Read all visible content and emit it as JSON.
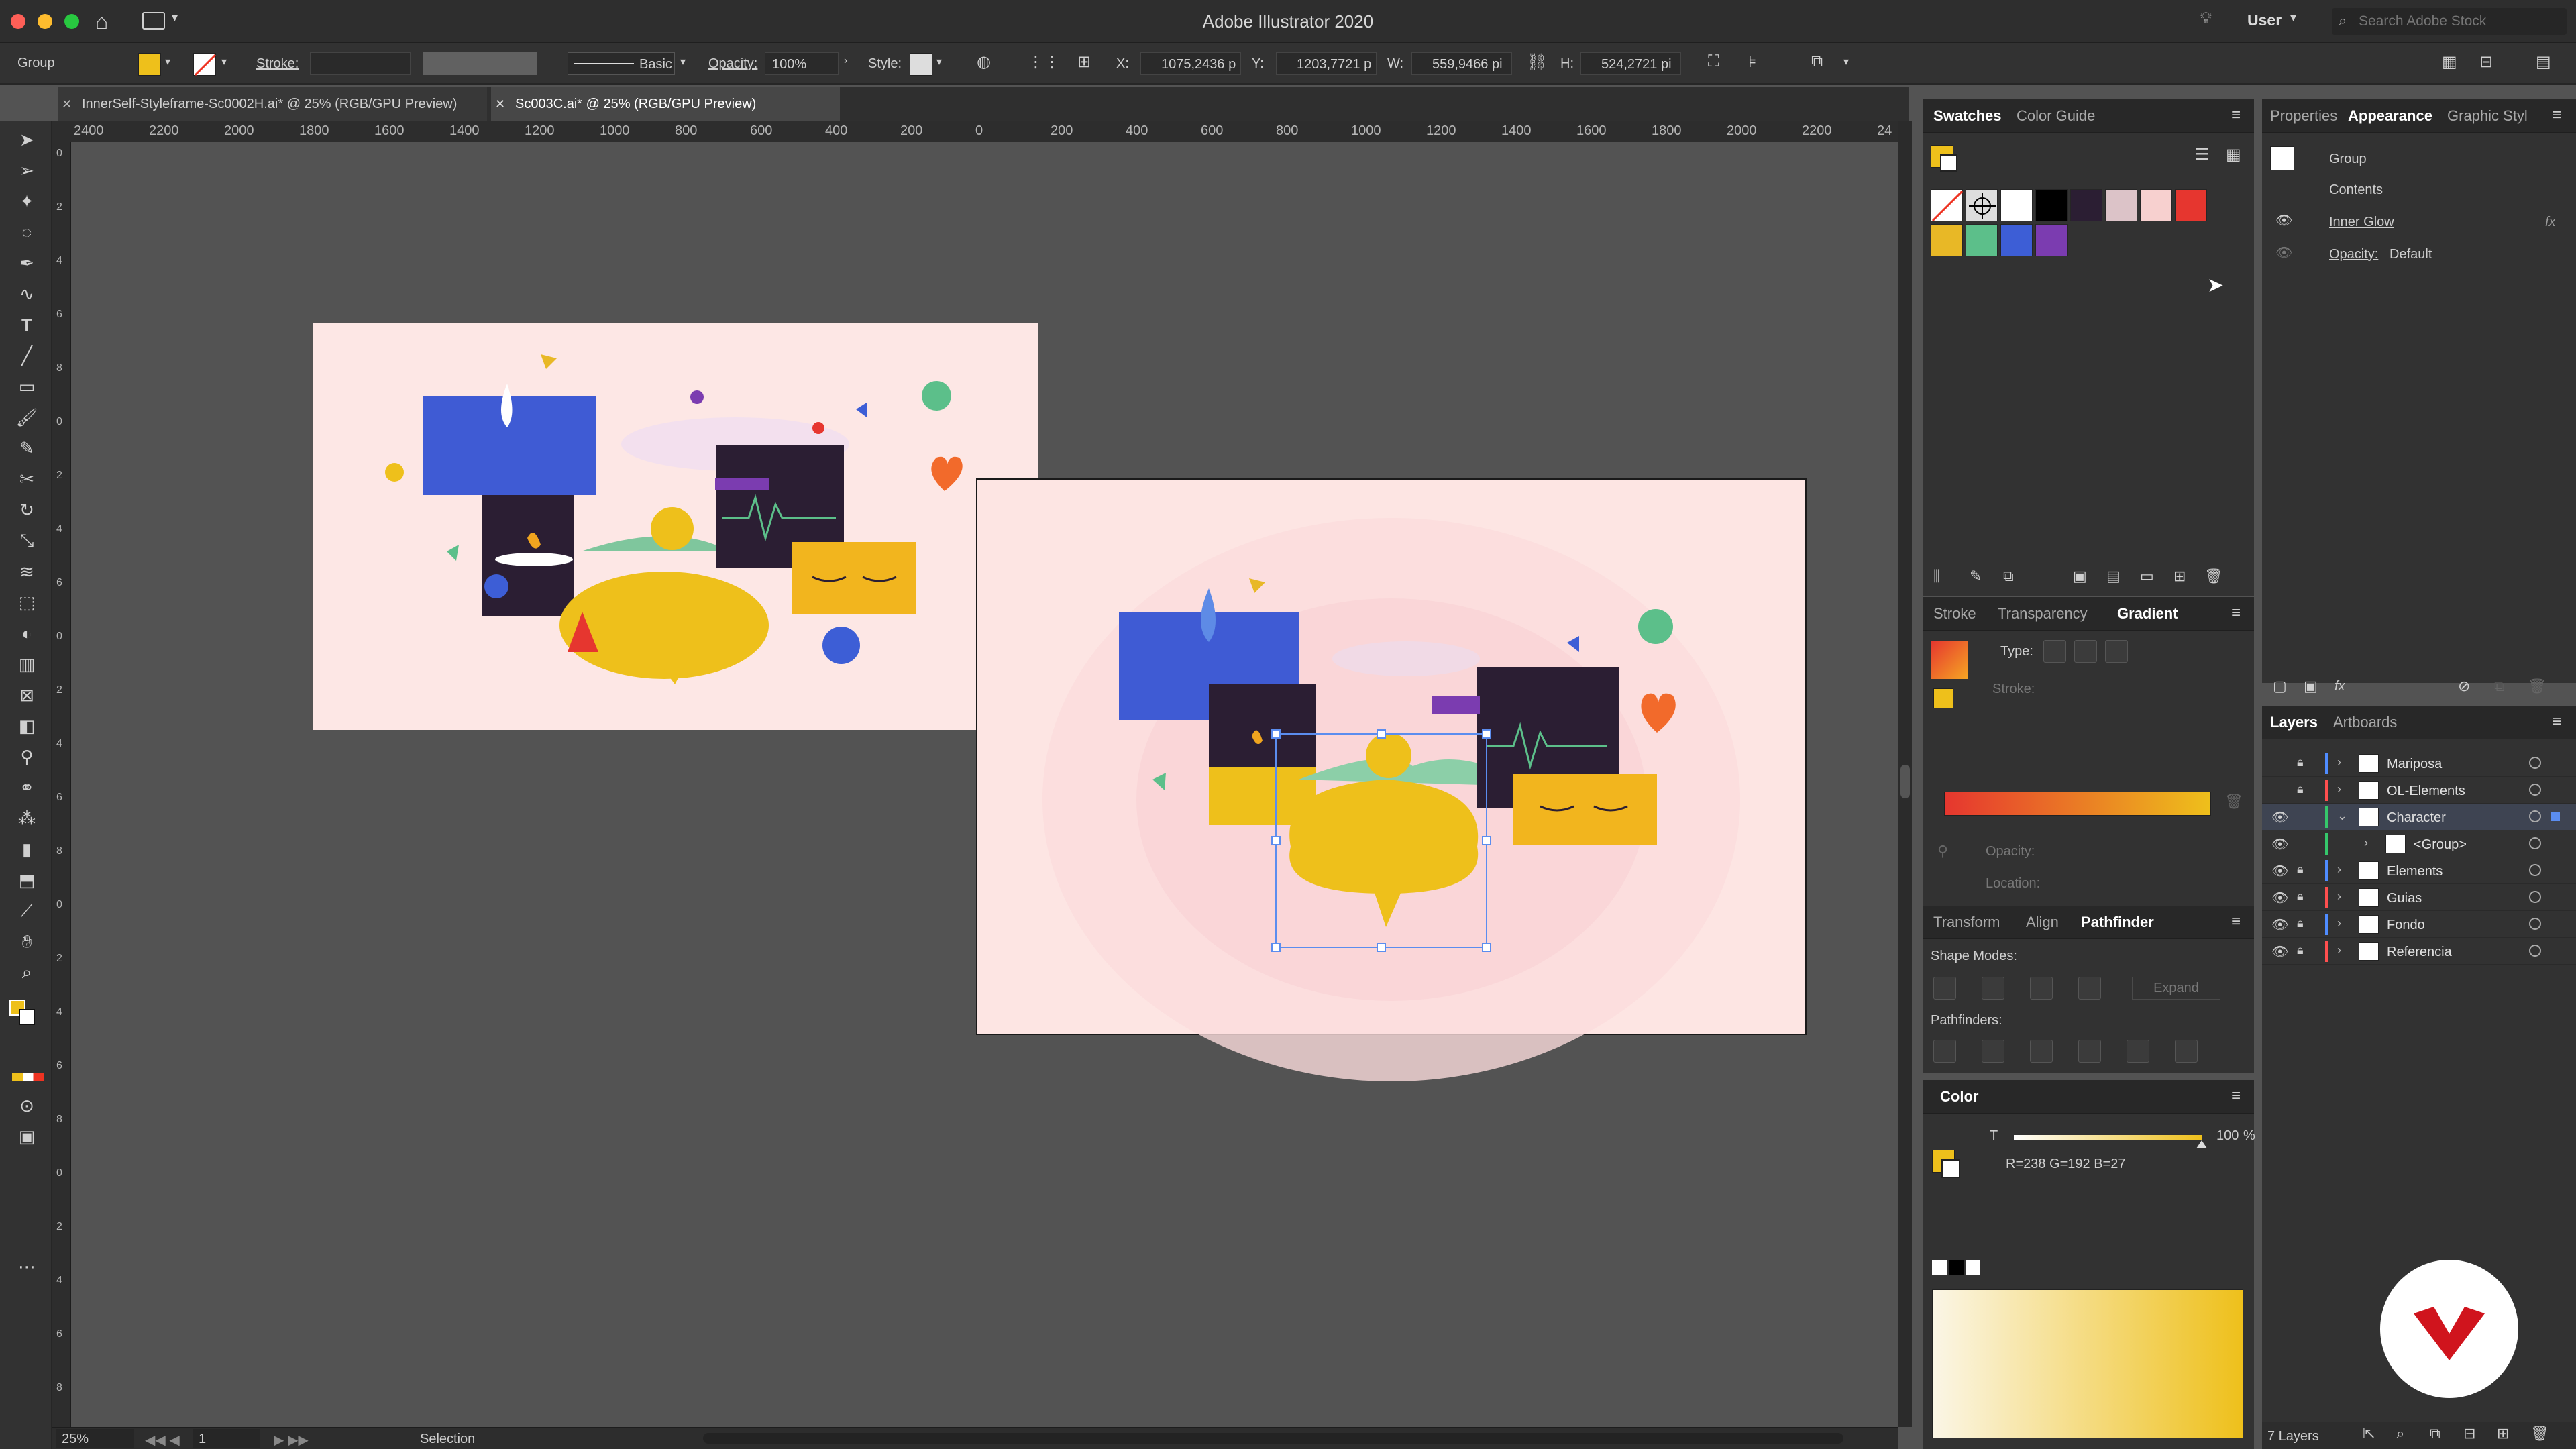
{
  "app": {
    "title": "Adobe Illustrator 2020",
    "workspace": "User",
    "search_placeholder": "Search Adobe Stock"
  },
  "control_bar": {
    "selection_type": "Group",
    "stroke_label": "Stroke:",
    "brush": "Basic",
    "opacity_label": "Opacity:",
    "opacity_value": "100%",
    "style_label": "Style:",
    "x_label": "X:",
    "x_value": "1075,2436 p",
    "y_label": "Y:",
    "y_value": "1203,7721 p",
    "w_label": "W:",
    "w_value": "559,9466 pi",
    "h_label": "H:",
    "h_value": "524,2721 pi"
  },
  "doc_tabs": [
    {
      "label": "InnerSelf-Styleframe-Sc0002H.ai* @ 25% (RGB/GPU Preview)",
      "active": false
    },
    {
      "label": "Sc003C.ai* @ 25% (RGB/GPU Preview)",
      "active": true
    }
  ],
  "ruler_labels": [
    "2400",
    "2200",
    "2000",
    "1800",
    "1600",
    "1400",
    "1200",
    "1000",
    "800",
    "600",
    "400",
    "200",
    "0",
    "200",
    "400",
    "600",
    "800",
    "1000",
    "1200",
    "1400",
    "1600",
    "1800",
    "2000",
    "2200",
    "24"
  ],
  "vruler_labels": [
    "0",
    "2",
    "4",
    "6",
    "8",
    "0",
    "2",
    "4",
    "6",
    "0",
    "2",
    "4",
    "6",
    "8",
    "0",
    "2",
    "4",
    "6",
    "8",
    "0",
    "2",
    "4",
    "6",
    "8"
  ],
  "status": {
    "zoom": "25%",
    "artboard": "1",
    "tool": "Selection"
  },
  "swatches": {
    "tabs": [
      "Swatches",
      "Color Guide"
    ],
    "colors": [
      "#ffffff",
      "#000000",
      "#2b1e33",
      "#dcc3c8",
      "#f7d0cf",
      "#e6362f",
      "#e8b826",
      "#5cbf8a",
      "#3d5ed6",
      "#7b3cb0"
    ]
  },
  "appearance": {
    "tabs": [
      "Properties",
      "Appearance",
      "Graphic Styl"
    ],
    "title": "Group",
    "contents": "Contents",
    "effect": "Inner Glow",
    "effect_fx": "fx",
    "opacity": "Opacity:",
    "opacity_value": "Default"
  },
  "gradient": {
    "tabs": [
      "Stroke",
      "Transparency",
      "Gradient"
    ],
    "type_label": "Type:",
    "stroke_label": "Stroke:",
    "opacity_label": "Opacity:",
    "location_label": "Location:"
  },
  "pathfinder": {
    "tabs": [
      "Transform",
      "Align",
      "Pathfinder"
    ],
    "shape_modes": "Shape Modes:",
    "expand": "Expand",
    "pathfinders": "Pathfinders:"
  },
  "color_panel": {
    "tab": "Color",
    "tint_label": "T",
    "tint_value": "100",
    "tint_unit": "%",
    "tint_level": 1.0,
    "rgb": "R=238 G=192 B=27"
  },
  "layers": {
    "tabs": [
      "Layers",
      "Artboards"
    ],
    "items": [
      {
        "name": "Mariposa",
        "color": "#4f8cff",
        "visible": false,
        "locked": true,
        "indent": 0
      },
      {
        "name": "OL-Elements",
        "color": "#ff4f4f",
        "visible": false,
        "locked": true,
        "indent": 0
      },
      {
        "name": "Character",
        "color": "#35c76b",
        "visible": true,
        "locked": false,
        "indent": 0,
        "selected": true
      },
      {
        "name": "<Group>",
        "color": "#35c76b",
        "visible": true,
        "locked": false,
        "indent": 1
      },
      {
        "name": "Elements",
        "color": "#4f8cff",
        "visible": true,
        "locked": true,
        "indent": 0
      },
      {
        "name": "Guias",
        "color": "#ff4f4f",
        "visible": true,
        "locked": true,
        "indent": 0
      },
      {
        "name": "Fondo",
        "color": "#4f8cff",
        "visible": true,
        "locked": true,
        "indent": 0
      },
      {
        "name": "Referencia",
        "color": "#ff4f4f",
        "visible": true,
        "locked": true,
        "indent": 0
      }
    ],
    "count": "7 Layers"
  },
  "colors": {
    "fill": "#eec01b",
    "accent": "#5b8def"
  }
}
